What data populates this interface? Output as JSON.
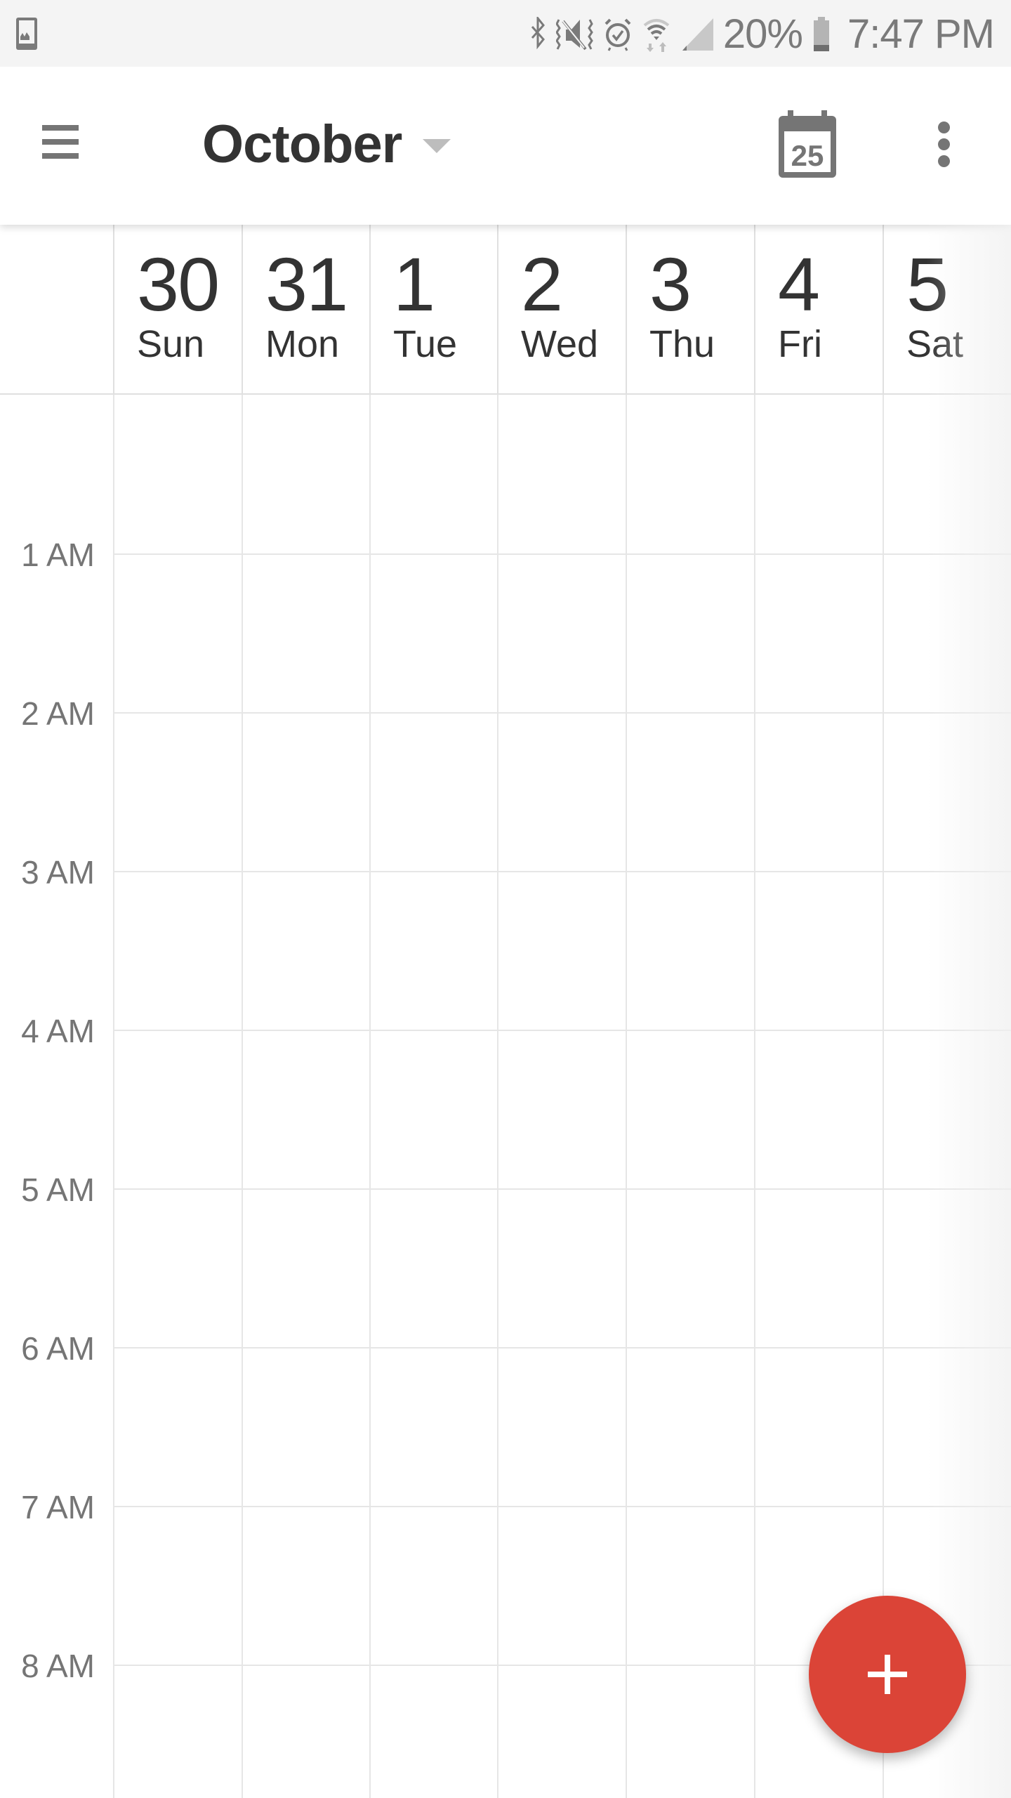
{
  "status_bar": {
    "left_icons": [
      "gallery-notification-icon"
    ],
    "right_icons": [
      "bluetooth-icon",
      "mute-vibrate-icon",
      "alarm-icon",
      "wifi-icon",
      "cell-signal-icon",
      "battery-icon"
    ],
    "battery_percent": "20%",
    "battery_level": 0.2,
    "time": "7:47 PM"
  },
  "app_bar": {
    "menu_icon": "hamburger-menu-icon",
    "month": "October",
    "month_dropdown_icon": "caret-down-icon",
    "today_icon": "calendar-today-icon",
    "today_date": "25",
    "overflow_icon": "more-vert-icon"
  },
  "week": {
    "days": [
      {
        "num": "30",
        "name": "Sun"
      },
      {
        "num": "31",
        "name": "Mon"
      },
      {
        "num": "1",
        "name": "Tue"
      },
      {
        "num": "2",
        "name": "Wed"
      },
      {
        "num": "3",
        "name": "Thu"
      },
      {
        "num": "4",
        "name": "Fri"
      },
      {
        "num": "5",
        "name": "Sat"
      }
    ]
  },
  "hours": [
    "1 AM",
    "2 AM",
    "3 AM",
    "4 AM",
    "5 AM",
    "6 AM",
    "7 AM",
    "8 AM"
  ],
  "fab": {
    "icon": "plus-icon",
    "label": "+",
    "color": "#db4437"
  },
  "colors": {
    "accent": "#db4437",
    "text_primary": "#333333",
    "text_secondary": "#757575",
    "gridline": "#e6e6e6",
    "status_bar_bg": "#f4f4f4"
  }
}
